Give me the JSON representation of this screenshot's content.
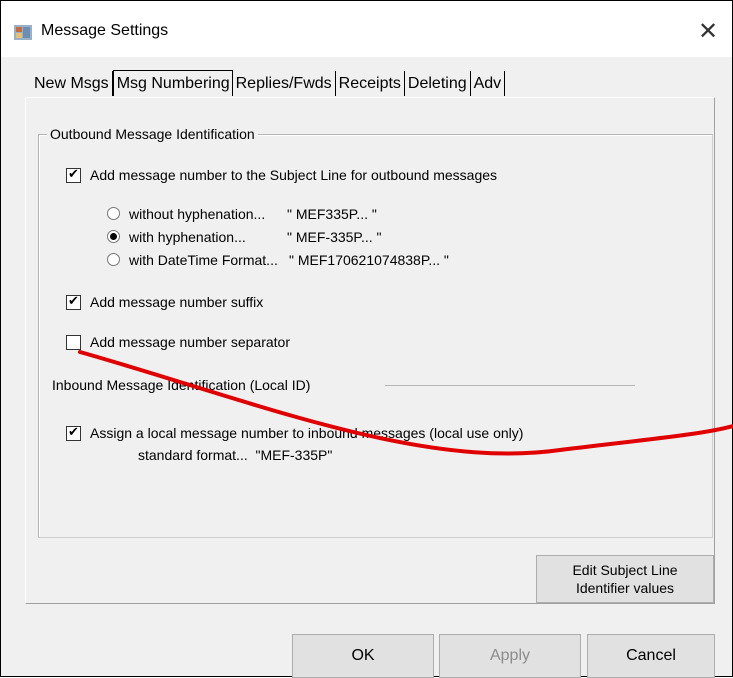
{
  "window": {
    "title": "Message Settings",
    "close_glyph": "✕"
  },
  "tabs": [
    {
      "label": "New Msgs",
      "active": false
    },
    {
      "label": "Msg Numbering",
      "active": true
    },
    {
      "label": "Replies/Fwds",
      "active": false
    },
    {
      "label": "Receipts",
      "active": false
    },
    {
      "label": "Deleting",
      "active": false
    },
    {
      "label": "Adv",
      "active": false
    }
  ],
  "outbound": {
    "group_title": "Outbound Message Identification",
    "add_subject": {
      "label": "Add message number to the Subject Line for outbound messages",
      "checked": true
    },
    "radios": [
      {
        "label": "without hyphenation...",
        "example": "\" MEF335P... \"",
        "selected": false
      },
      {
        "label": "with hyphenation...",
        "example": "\" MEF-335P... \"",
        "selected": true
      },
      {
        "label": "with DateTime Format...",
        "example": "\" MEF170621074838P... \"",
        "selected": false
      }
    ],
    "suffix": {
      "label": "Add message number suffix",
      "checked": true
    },
    "separator": {
      "label": "Add message number separator",
      "checked": false
    }
  },
  "inbound": {
    "group_title": "Inbound Message Identification (Local ID)",
    "assign_local": {
      "label": "Assign a local message number to inbound messages (local use only)",
      "checked": true
    },
    "format_text": "standard format...  \"MEF-335P\""
  },
  "buttons": {
    "edit_line1": "Edit Subject Line",
    "edit_line2": "Identifier values",
    "ok": "OK",
    "apply": "Apply",
    "cancel": "Cancel"
  },
  "colors": {
    "annotation": "#e00000",
    "window_bg": "#f0f0f0",
    "button_bg": "#e1e1e1"
  },
  "icons": {
    "app": "app-icon",
    "close": "close-icon",
    "check": "checkmark-icon"
  }
}
